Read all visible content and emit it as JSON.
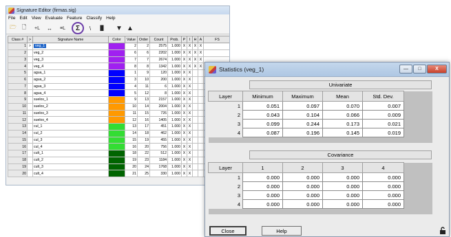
{
  "signature_editor": {
    "title": "Signature Editor (firmas.sig)",
    "menu": [
      "File",
      "Edit",
      "View",
      "Evaluate",
      "Feature",
      "Classify",
      "Help"
    ],
    "toolbar": {
      "open": "🗁",
      "new": "🗋",
      "add": "+L",
      "replace": "↔",
      "merge": "≡L",
      "stats": "Σ",
      "mean_plot": "\\",
      "histogram": "▐▌",
      "move_down": "▼",
      "move_up": "▲"
    },
    "columns": [
      "Class #",
      ">",
      "Signature Name",
      "Color",
      "Value",
      "Order",
      "Count",
      "Prob.",
      "P",
      "I",
      "H",
      "A",
      "FS"
    ],
    "rows": [
      {
        "cls": "1",
        "arrow": ">",
        "name": "veg_1",
        "color": "#a020f0",
        "value": "2",
        "order": "2",
        "count": "2575",
        "prob": "1.000",
        "p": "X",
        "i": "X",
        "h": "X",
        "a": "X",
        "selected": true
      },
      {
        "cls": "2",
        "arrow": "",
        "name": "veg_2",
        "color": "#a020f0",
        "value": "6",
        "order": "6",
        "count": "2202",
        "prob": "1.000",
        "p": "X",
        "i": "X",
        "h": "X",
        "a": "X"
      },
      {
        "cls": "3",
        "arrow": "",
        "name": "veg_3",
        "color": "#a020f0",
        "value": "7",
        "order": "7",
        "count": "2674",
        "prob": "1.000",
        "p": "X",
        "i": "X",
        "h": "X",
        "a": "X"
      },
      {
        "cls": "4",
        "arrow": "",
        "name": "veg_4",
        "color": "#a020f0",
        "value": "8",
        "order": "8",
        "count": "1342",
        "prob": "1.000",
        "p": "X",
        "i": "X",
        "h": "X",
        "a": "X"
      },
      {
        "cls": "5",
        "arrow": "",
        "name": "agua_1",
        "color": "#0000ff",
        "value": "1",
        "order": "9",
        "count": "120",
        "prob": "1.000",
        "p": "X",
        "i": "X",
        "h": "",
        "a": ""
      },
      {
        "cls": "6",
        "arrow": "",
        "name": "agua_2",
        "color": "#0000ff",
        "value": "3",
        "order": "10",
        "count": "200",
        "prob": "1.000",
        "p": "X",
        "i": "X",
        "h": "",
        "a": ""
      },
      {
        "cls": "7",
        "arrow": "",
        "name": "agua_3",
        "color": "#0000ff",
        "value": "4",
        "order": "11",
        "count": "6",
        "prob": "1.000",
        "p": "X",
        "i": "X",
        "h": "",
        "a": ""
      },
      {
        "cls": "8",
        "arrow": "",
        "name": "agua_4",
        "color": "#0000ff",
        "value": "5",
        "order": "12",
        "count": "8",
        "prob": "1.000",
        "p": "X",
        "i": "X",
        "h": "",
        "a": ""
      },
      {
        "cls": "9",
        "arrow": "",
        "name": "suelos_1",
        "color": "#ff9900",
        "value": "9",
        "order": "13",
        "count": "2157",
        "prob": "1.000",
        "p": "X",
        "i": "X",
        "h": "",
        "a": ""
      },
      {
        "cls": "10",
        "arrow": "",
        "name": "suelos_2",
        "color": "#ff9900",
        "value": "10",
        "order": "14",
        "count": "2004",
        "prob": "1.000",
        "p": "X",
        "i": "X",
        "h": "",
        "a": ""
      },
      {
        "cls": "11",
        "arrow": "",
        "name": "suelos_3",
        "color": "#ff9900",
        "value": "11",
        "order": "15",
        "count": "726",
        "prob": "1.000",
        "p": "X",
        "i": "X",
        "h": "",
        "a": ""
      },
      {
        "cls": "12",
        "arrow": "",
        "name": "suelos_4",
        "color": "#ff9900",
        "value": "12",
        "order": "16",
        "count": "1405",
        "prob": "1.000",
        "p": "X",
        "i": "X",
        "h": "",
        "a": ""
      },
      {
        "cls": "13",
        "arrow": "",
        "name": "cul_1",
        "color": "#33dd33",
        "value": "13",
        "order": "17",
        "count": "451",
        "prob": "1.000",
        "p": "X",
        "i": "X",
        "h": "",
        "a": ""
      },
      {
        "cls": "14",
        "arrow": "",
        "name": "cul_2",
        "color": "#33dd33",
        "value": "14",
        "order": "18",
        "count": "462",
        "prob": "1.000",
        "p": "X",
        "i": "X",
        "h": "",
        "a": ""
      },
      {
        "cls": "15",
        "arrow": "",
        "name": "cul_3",
        "color": "#33dd33",
        "value": "15",
        "order": "19",
        "count": "455",
        "prob": "1.000",
        "p": "X",
        "i": "X",
        "h": "",
        "a": ""
      },
      {
        "cls": "16",
        "arrow": "",
        "name": "cul_4",
        "color": "#33dd33",
        "value": "16",
        "order": "20",
        "count": "756",
        "prob": "1.000",
        "p": "X",
        "i": "X",
        "h": "",
        "a": ""
      },
      {
        "cls": "17",
        "arrow": "",
        "name": "cult_1",
        "color": "#006400",
        "value": "18",
        "order": "22",
        "count": "512",
        "prob": "1.000",
        "p": "X",
        "i": "X",
        "h": "",
        "a": ""
      },
      {
        "cls": "18",
        "arrow": "",
        "name": "cult_2",
        "color": "#006400",
        "value": "19",
        "order": "23",
        "count": "1184",
        "prob": "1.000",
        "p": "X",
        "i": "X",
        "h": "",
        "a": ""
      },
      {
        "cls": "19",
        "arrow": "",
        "name": "cult_3",
        "color": "#006400",
        "value": "20",
        "order": "24",
        "count": "1768",
        "prob": "1.000",
        "p": "X",
        "i": "X",
        "h": "",
        "a": ""
      },
      {
        "cls": "20",
        "arrow": "",
        "name": "cult_4",
        "color": "#006400",
        "value": "21",
        "order": "25",
        "count": "330",
        "prob": "1.000",
        "p": "X",
        "i": "X",
        "h": "",
        "a": ""
      }
    ]
  },
  "statistics": {
    "title": "Statistics (veg_1)",
    "univariate": {
      "title": "Univariate",
      "columns": [
        "Layer",
        "Minimum",
        "Maximum",
        "Mean",
        "Std. Dev."
      ],
      "rows": [
        {
          "layer": "1",
          "values": [
            "0.051",
            "0.097",
            "0.070",
            "0.007"
          ]
        },
        {
          "layer": "2",
          "values": [
            "0.043",
            "0.104",
            "0.066",
            "0.009"
          ]
        },
        {
          "layer": "3",
          "values": [
            "0.099",
            "0.244",
            "0.173",
            "0.021"
          ]
        },
        {
          "layer": "4",
          "values": [
            "0.087",
            "0.196",
            "0.145",
            "0.019"
          ]
        }
      ]
    },
    "covariance": {
      "title": "Covariance",
      "columns": [
        "Layer",
        "1",
        "2",
        "3",
        "4"
      ],
      "rows": [
        {
          "layer": "1",
          "values": [
            "0.000",
            "0.000",
            "0.000",
            "0.000"
          ]
        },
        {
          "layer": "2",
          "values": [
            "0.000",
            "0.000",
            "0.000",
            "0.000"
          ]
        },
        {
          "layer": "3",
          "values": [
            "0.000",
            "0.000",
            "0.000",
            "0.000"
          ]
        },
        {
          "layer": "4",
          "values": [
            "0.000",
            "0.000",
            "0.000",
            "0.000"
          ]
        }
      ]
    },
    "buttons": {
      "close": "Close",
      "help": "Help"
    },
    "window_controls": {
      "minimize": "—",
      "maximize": "□",
      "close": "X"
    }
  },
  "colors": {
    "selection": "#1e64c8",
    "highlight_circle": "#6a3aa8"
  }
}
